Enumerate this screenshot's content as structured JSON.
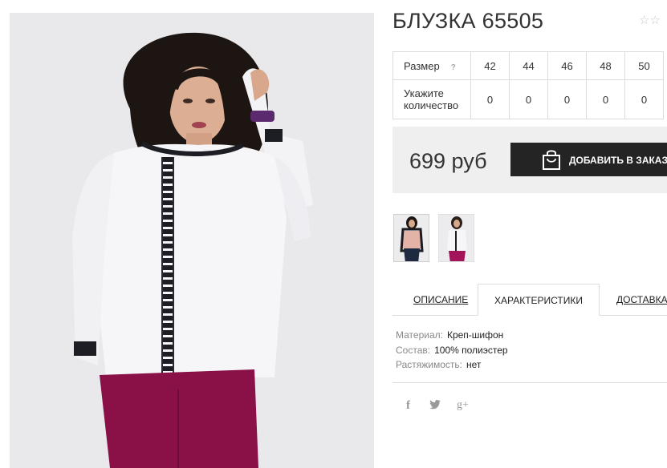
{
  "product": {
    "title": "БЛУЗКА 65505",
    "rating_stars": "☆☆"
  },
  "size_table": {
    "size_label": "Размер",
    "help_icon": "?",
    "sizes": [
      "42",
      "44",
      "46",
      "48",
      "50"
    ],
    "quantity_label": "Укажите количество",
    "quantities": [
      "0",
      "0",
      "0",
      "0",
      "0"
    ]
  },
  "price": {
    "amount": "699 руб",
    "add_button_label": "ДОБАВИТЬ В ЗАКАЗ",
    "button_icon": "shopping-bag-icon"
  },
  "tabs": [
    {
      "label": "ОПИСАНИЕ",
      "active": false
    },
    {
      "label": "ХАРАКТЕРИСТИКИ",
      "active": true
    },
    {
      "label": "ДОСТАВКА И",
      "active": false
    }
  ],
  "specs": [
    {
      "key": "Материал:",
      "value": "Креп-шифон"
    },
    {
      "key": "Состав:",
      "value": "100% полиэстер"
    },
    {
      "key": "Растяжимость:",
      "value": "нет"
    }
  ],
  "social": {
    "facebook": "f",
    "twitter": "🐦",
    "googleplus": "g+"
  },
  "colors": {
    "button_bg": "#242424",
    "price_box_bg": "#efefef",
    "blouse": "#f6f6f8",
    "trousers": "#8a1048"
  }
}
